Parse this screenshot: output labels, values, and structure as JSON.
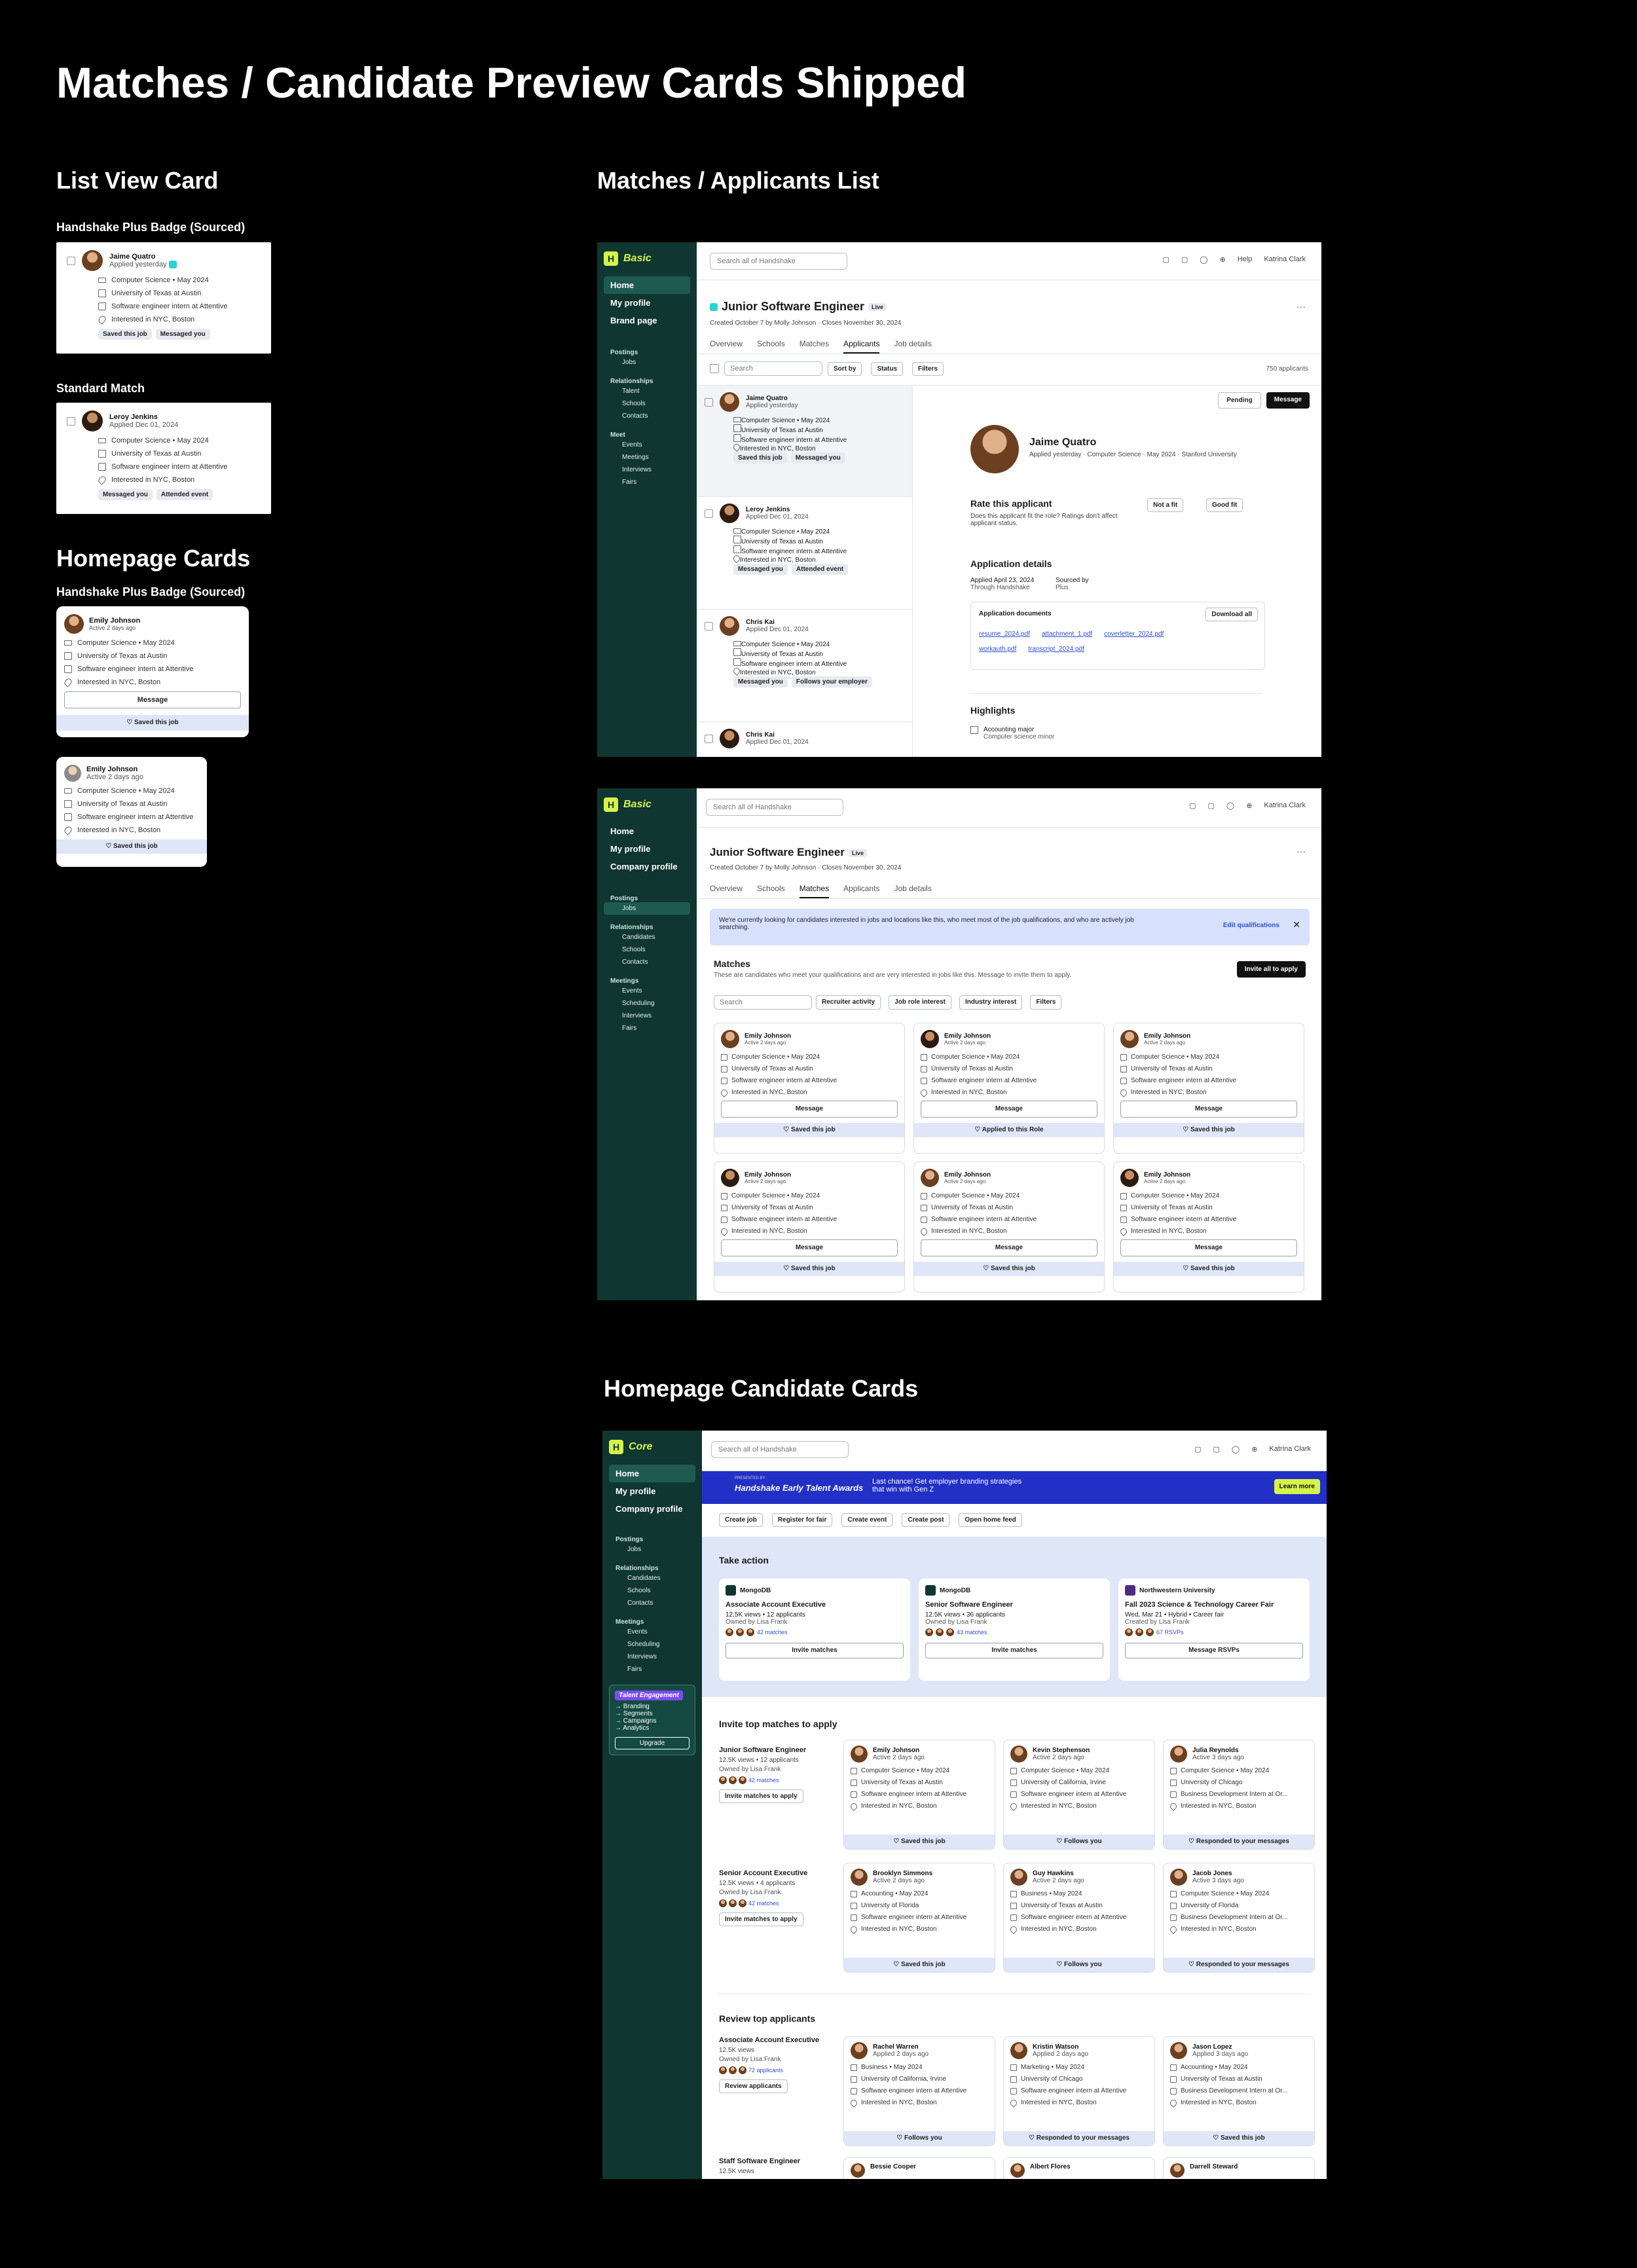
{
  "page_title": "Matches / Candidate Preview Cards Shipped",
  "sections": {
    "list_view": "List View Card",
    "matches_list": "Matches / Applicants List",
    "homepage_cards": "Homepage Cards",
    "homepage_candidate": "Homepage Candidate Cards"
  },
  "list_cards": {
    "plus_label": "Handshake Plus Badge (Sourced)",
    "standard_label": "Standard Match",
    "plus": {
      "name": "Jaime Quatro",
      "status": "Applied yesterday",
      "rows": [
        "Computer Science • May 2024",
        "University of Texas at Austin",
        "Software engineer intern at Attentive",
        "Interested in NYC, Boston"
      ],
      "tags": [
        "Saved this job",
        "Messaged you"
      ]
    },
    "standard": {
      "name": "Leroy Jenkins",
      "status": "Applied Dec 01, 2024",
      "rows": [
        "Computer Science • May 2024",
        "University of Texas at Austin",
        "Software engineer intern at Attentive",
        "Interested in NYC, Boston"
      ],
      "tags": [
        "Messaged you",
        "Attended event"
      ]
    }
  },
  "home_cards": {
    "plus_label": "Handshake Plus Badge (Sourced)",
    "wide": {
      "name": "Emily Johnson",
      "status": "Active 2 days ago",
      "rows": [
        "Computer Science • May 2024",
        "University of Texas at Austin",
        "Software engineer intern at Attentive",
        "Interested in NYC, Boston"
      ],
      "message": "Message",
      "footer": "Saved this job"
    },
    "small": {
      "name": "Emily Johnson",
      "status": "Active 2 days ago",
      "rows": [
        "Computer Science • May 2024",
        "University of Texas at Austin",
        "Software engineer intern at Attentive",
        "Interested in NYC, Boston"
      ],
      "footer": "Saved this job"
    }
  },
  "app_common": {
    "logo_basic": "Basic",
    "logo_core": "Core",
    "logo_mark": "H",
    "search_placeholder": "Search all of Handshake",
    "help": "Help",
    "user": "Katrina Clark",
    "job_title": "Junior Software Engineer",
    "live": "Live",
    "job_meta": "Created October 7 by Molly Johnson · Closes November 30, 2024",
    "tabs": [
      "Overview",
      "Schools",
      "Matches",
      "Applicants",
      "Job details"
    ]
  },
  "app1": {
    "nav": [
      "Home",
      "My profile",
      "Brand page"
    ],
    "sections": [
      {
        "title": "Postings",
        "items": [
          "Jobs"
        ]
      },
      {
        "title": "Relationships",
        "items": [
          "Talent",
          "Schools",
          "Contacts"
        ]
      },
      {
        "title": "Meet",
        "items": [
          "Events",
          "Meetings",
          "Interviews",
          "Fairs"
        ]
      }
    ],
    "list_search": "Search",
    "sort": "Sort by",
    "status": "Status",
    "filters": "Filters",
    "count": "750 applicants",
    "applicants": [
      {
        "name": "Jaime Quatro",
        "status": "Applied yesterday",
        "rows": [
          "Computer Science • May 2024",
          "University of Texas at Austin",
          "Software engineer intern at Attentive",
          "Interested in NYC, Boston"
        ],
        "tags": [
          "Saved this job",
          "Messaged you"
        ]
      },
      {
        "name": "Leroy Jenkins",
        "status": "Applied Dec 01, 2024",
        "rows": [
          "Computer Science • May 2024",
          "University of Texas at Austin",
          "Software engineer intern at Attentive",
          "Interested in NYC, Boston"
        ],
        "tags": [
          "Messaged you",
          "Attended event"
        ]
      },
      {
        "name": "Chris Kai",
        "status": "Applied Dec 01, 2024",
        "rows": [
          "Computer Science • May 2024",
          "University of Texas at Austin",
          "Software engineer intern at Attentive",
          "Interested in NYC, Boston"
        ],
        "tags": [
          "Messaged you",
          "Follows your employer"
        ]
      },
      {
        "name": "Chris Kai",
        "status": "Applied Dec 01, 2024",
        "rows": [],
        "tags": []
      }
    ],
    "pending": "Pending",
    "message": "Message",
    "detail": {
      "name": "Jaime Quatro",
      "meta": "Applied yesterday · Computer Science · May 2024 · Stanford University",
      "rate_title": "Rate this applicant",
      "rate_text": "Does this applicant fit the role? Ratings don't affect applicant status.",
      "not_fit": "Not a fit",
      "good_fit": "Good fit",
      "app_details": "Application details",
      "applied": "Applied April 23, 2024",
      "through": "Through Handshake",
      "sourced": "Sourced by",
      "sourced_by": "Plus",
      "docs_title": "Application documents",
      "download": "Download all",
      "docs": [
        "resume_2024.pdf",
        "attachment_1.pdf",
        "coverletter_2024.pdf",
        "workauth.pdf",
        "transcript_2024.pdf"
      ],
      "highlights": "Highlights",
      "hl_1": "Accounting major",
      "hl_2": "Computer science minor"
    }
  },
  "app2": {
    "nav": [
      "Home",
      "My profile",
      "Company profile"
    ],
    "sections": [
      {
        "title": "Postings",
        "items": [
          "Jobs"
        ]
      },
      {
        "title": "Relationships",
        "items": [
          "Candidates",
          "Schools",
          "Contacts"
        ]
      },
      {
        "title": "Meetings",
        "items": [
          "Events",
          "Scheduling",
          "Interviews",
          "Fairs"
        ]
      }
    ],
    "banner": "We're currently looking for candidates interested in jobs and locations like this, who meet most of the job qualifications, and who are actively job searching.",
    "edit": "Edit qualifications",
    "matches_title": "Matches",
    "matches_sub": "These are candidates who meet your qualifications and are very interested in jobs like this. Message to invite them to apply.",
    "invite_all": "Invite all to apply",
    "search": "Search",
    "filters": [
      "Recruiter activity",
      "Job role interest",
      "Industry interest",
      "Filters"
    ],
    "cards": [
      {
        "name": "Emily Johnson",
        "status": "Active 2 days ago",
        "footer": "Saved this job"
      },
      {
        "name": "Emily Johnson",
        "status": "Active 2 days ago",
        "footer": "Applied to this Role"
      },
      {
        "name": "Emily Johnson",
        "status": "Active 2 days ago",
        "footer": "Saved this job"
      },
      {
        "name": "Emily Johnson",
        "status": "Active 2 days ago",
        "footer": "Saved this job"
      },
      {
        "name": "Emily Johnson",
        "status": "Active 2 days ago",
        "footer": "Saved this job"
      },
      {
        "name": "Emily Johnson",
        "status": "Active 2 days ago",
        "footer": "Saved this job"
      }
    ],
    "rows": [
      "Computer Science • May 2024",
      "University of Texas at Austin",
      "Software engineer intern at Attentive",
      "Interested in NYC, Boston"
    ],
    "message": "Message"
  },
  "app3": {
    "nav": [
      "Home",
      "My profile",
      "Company profile"
    ],
    "sections": [
      {
        "title": "Postings",
        "items": [
          "Jobs"
        ]
      },
      {
        "title": "Relationships",
        "items": [
          "Candidates",
          "Schools",
          "Contacts"
        ]
      },
      {
        "title": "Meetings",
        "items": [
          "Events",
          "Scheduling",
          "Interviews",
          "Fairs"
        ]
      }
    ],
    "te_title": "Talent Engagement",
    "te_links": [
      "Branding",
      "Segments",
      "Campaigns",
      "Analytics"
    ],
    "upgrade": "Upgrade",
    "promo_small": "PRESENTED BY",
    "promo_brand": "Handshake Early Talent Awards",
    "promo_text": "Last chance! Get employer branding strategies that win with Gen Z",
    "learn": "Learn more",
    "quick": [
      "Create job",
      "Register for fair",
      "Create event",
      "Create post",
      "Open home feed"
    ],
    "take_action": "Take action",
    "actions": [
      {
        "org": "MongoDB",
        "title": "Associate Account Executive",
        "meta": "12.5K views • 12 applicants",
        "owner": "Owned by Lisa Frank",
        "count": "42 matches",
        "btn": "Invite matches"
      },
      {
        "org": "MongoDB",
        "title": "Senior Software Engineer",
        "meta": "12.5K views • 36 applicants",
        "owner": "Owned by Lisa Frank",
        "count": "43 matches",
        "btn": "Invite matches"
      },
      {
        "org": "Northwestern University",
        "title": "Fall 2023 Science & Technology Career Fair",
        "meta": "Wed, Mar 21 • Hybrid • Career fair",
        "owner": "Created by Lisa Frank",
        "count": "67 RSVPs",
        "btn": "Message RSVPs"
      }
    ],
    "invite_title": "Invite top matches to apply",
    "invite_groups": [
      {
        "job": "Junior Software Engineer",
        "meta": "12.5K views • 12 applicants",
        "owner": "Owned by Lisa Frank",
        "count": "42 matches",
        "btn": "Invite matches to apply",
        "cards": [
          {
            "name": "Emily Johnson",
            "status": "Active 2 days ago",
            "rows": [
              "Computer Science • May 2024",
              "University of Texas at Austin",
              "Software engineer intern at Attentive",
              "Interested in NYC, Boston"
            ],
            "footer": "Saved this job"
          },
          {
            "name": "Kevin Stephenson",
            "status": "Active 2 days ago",
            "rows": [
              "Computer Science • May 2024",
              "University of California, Irvine",
              "Software engineer intern at Attentive",
              "Interested in NYC, Boston"
            ],
            "footer": "Follows you"
          },
          {
            "name": "Julia Reynolds",
            "status": "Active 3 days ago",
            "rows": [
              "Computer Science • May 2024",
              "University of Chicago",
              "Business Development Intern at Or...",
              "Interested in NYC, Boston"
            ],
            "footer": "Responded to your messages"
          }
        ]
      },
      {
        "job": "Senior Account Executive",
        "meta": "12.5K views • 4 applicants",
        "owner": "Owned by Lisa Frank",
        "count": "42 matches",
        "btn": "Invite matches to apply",
        "cards": [
          {
            "name": "Brooklyn Simmons",
            "status": "Active 2 days ago",
            "rows": [
              "Accounting • May 2024",
              "University of Florida",
              "Software engineer intern at Attentive",
              "Interested in NYC, Boston"
            ],
            "footer": "Saved this job"
          },
          {
            "name": "Guy Hawkins",
            "status": "Active 2 days ago",
            "rows": [
              "Business • May 2024",
              "University of Texas at Austin",
              "Software engineer intern at Attentive",
              "Interested in NYC, Boston"
            ],
            "footer": "Follows you"
          },
          {
            "name": "Jacob Jones",
            "status": "Active 3 days ago",
            "rows": [
              "Computer Science • May 2024",
              "University of Florida",
              "Business Development Intern at Or...",
              "Interested in NYC, Boston"
            ],
            "footer": "Responded to your messages"
          }
        ]
      }
    ],
    "review_title": "Review top applicants",
    "review_group": {
      "job": "Associate Account Executive",
      "meta": "12.5K views",
      "owner": "Owned by Lisa Frank",
      "count": "72 applicants",
      "btn": "Review applicants",
      "cards": [
        {
          "name": "Rachel Warren",
          "status": "Applied 2 days ago",
          "rows": [
            "Business • May 2024",
            "University of California, Irvine",
            "Software engineer intern at Attentive",
            "Interested in NYC, Boston"
          ],
          "footer": "Follows you"
        },
        {
          "name": "Kristin Watson",
          "status": "Applied 2 days ago",
          "rows": [
            "Marketing • May 2024",
            "University of Chicago",
            "Software engineer intern at Attentive",
            "Interested in NYC, Boston"
          ],
          "footer": "Responded to your messages"
        },
        {
          "name": "Jason Lopez",
          "status": "Applied 3 days ago",
          "rows": [
            "Accounting • May 2024",
            "University of Texas at Austin",
            "Business Development Intern at Or...",
            "Interested in NYC, Boston"
          ],
          "footer": "Saved this job"
        }
      ]
    },
    "staff": {
      "job": "Staff Software Engineer",
      "meta": "12.5K views",
      "names": [
        "Bessie Cooper",
        "Albert Flores",
        "Darrell Steward"
      ]
    }
  }
}
